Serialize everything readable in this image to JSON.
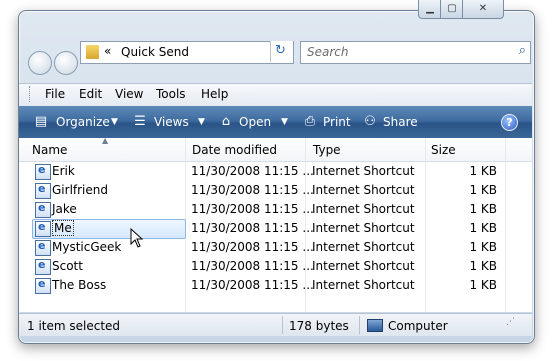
{
  "address": {
    "chevron": "«",
    "path": "Quick Send"
  },
  "search": {
    "placeholder": "Search"
  },
  "menu": [
    "File",
    "Edit",
    "View",
    "Tools",
    "Help"
  ],
  "toolbar": {
    "organize": "Organize",
    "views": "Views",
    "open": "Open",
    "print": "Print",
    "share": "Share",
    "help": "?"
  },
  "columns": {
    "name": "Name",
    "date": "Date modified",
    "type": "Type",
    "size": "Size"
  },
  "files": [
    {
      "name": "Erik",
      "date": "11/30/2008 11:15 ...",
      "type": "Internet Shortcut",
      "size": "1 KB"
    },
    {
      "name": "Girlfriend",
      "date": "11/30/2008 11:15 ...",
      "type": "Internet Shortcut",
      "size": "1 KB"
    },
    {
      "name": "Jake",
      "date": "11/30/2008 11:15 ...",
      "type": "Internet Shortcut",
      "size": "1 KB"
    },
    {
      "name": "Me",
      "date": "11/30/2008 11:15 ...",
      "type": "Internet Shortcut",
      "size": "1 KB",
      "selected": true
    },
    {
      "name": "MysticGeek",
      "date": "11/30/2008 11:15 ...",
      "type": "Internet Shortcut",
      "size": "1 KB"
    },
    {
      "name": "Scott",
      "date": "11/30/2008 11:15 ...",
      "type": "Internet Shortcut",
      "size": "1 KB"
    },
    {
      "name": "The Boss",
      "date": "11/30/2008 11:15 ...",
      "type": "Internet Shortcut",
      "size": "1 KB"
    }
  ],
  "status": {
    "selection": "1 item selected",
    "bytes": "178 bytes",
    "location": "Computer"
  }
}
